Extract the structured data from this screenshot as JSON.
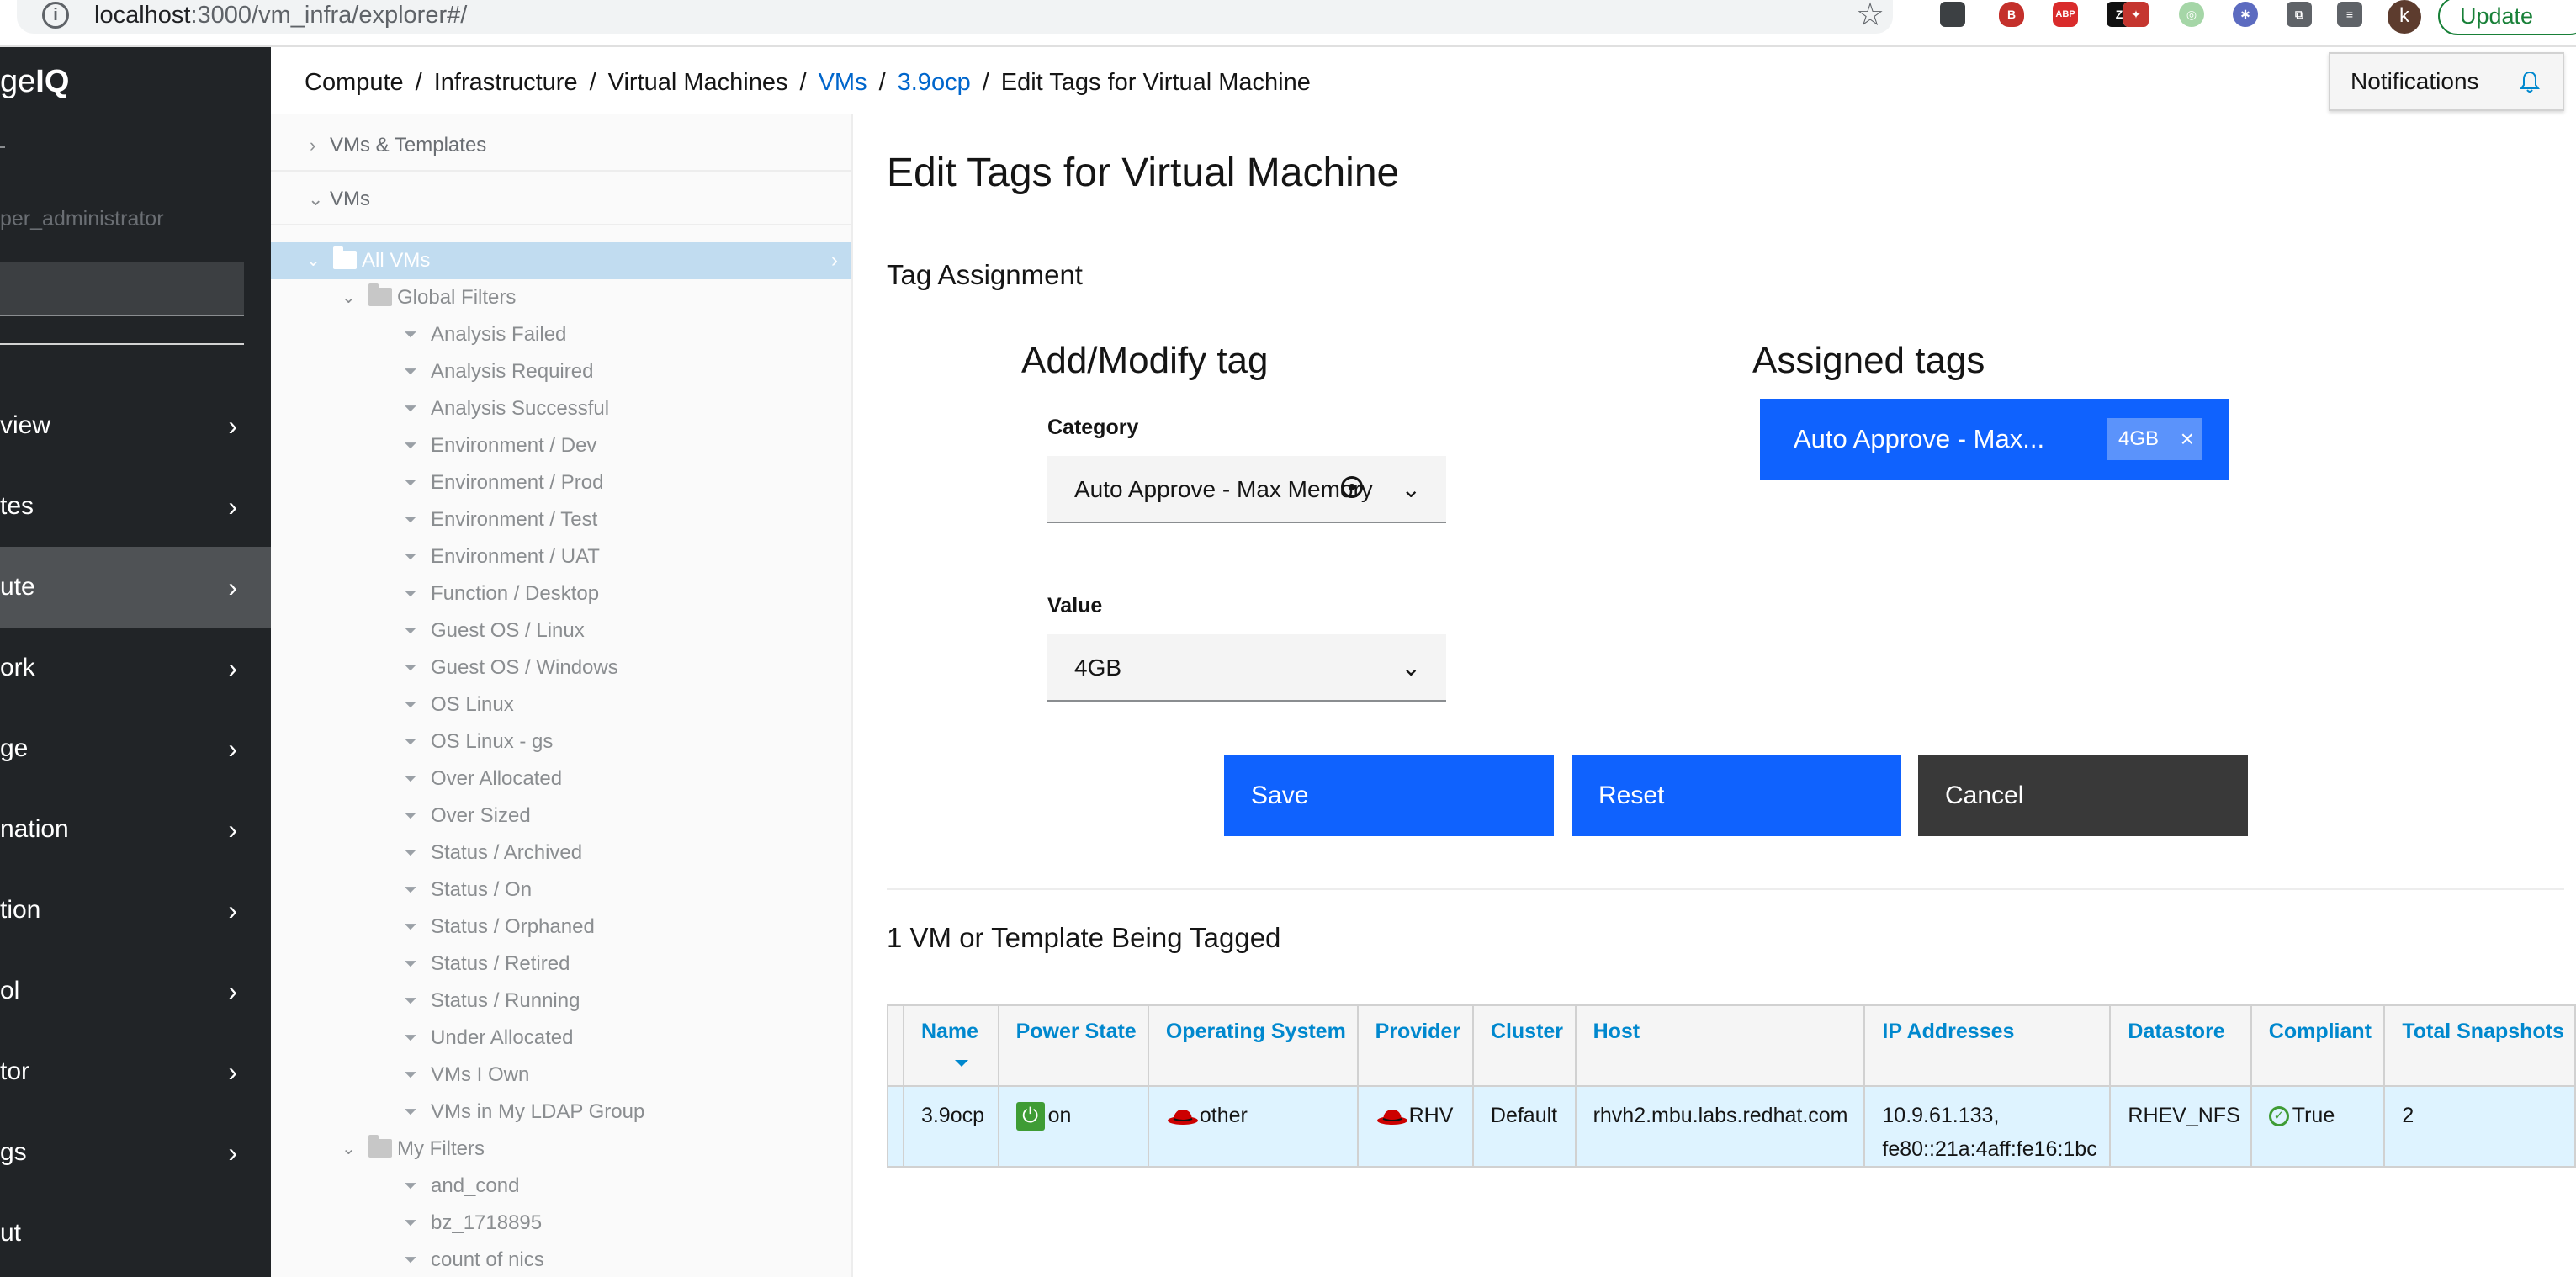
{
  "browser": {
    "url_host": "localhost",
    "url_path": ":3000/vm_infra/explorer#/",
    "avatar_letter": "k",
    "update_label": "Update"
  },
  "nav": {
    "brand_light": "ge",
    "brand_bold": "IQ",
    "role": "per_administrator",
    "items": [
      {
        "label": "view"
      },
      {
        "label": "tes"
      },
      {
        "label": "ute"
      },
      {
        "label": "ork"
      },
      {
        "label": "ge"
      },
      {
        "label": "nation"
      },
      {
        "label": "tion"
      },
      {
        "label": "ol"
      },
      {
        "label": "tor"
      },
      {
        "label": "gs"
      },
      {
        "label": "ut"
      }
    ]
  },
  "tree_panel": {
    "accordion_1": "VMs & Templates",
    "accordion_2": "VMs",
    "nodes": [
      {
        "label": "All VMs"
      },
      {
        "label": "Global Filters"
      },
      {
        "label": "Analysis Failed"
      },
      {
        "label": "Analysis Required"
      },
      {
        "label": "Analysis Successful"
      },
      {
        "label": "Environment / Dev"
      },
      {
        "label": "Environment / Prod"
      },
      {
        "label": "Environment / Test"
      },
      {
        "label": "Environment / UAT"
      },
      {
        "label": "Function / Desktop"
      },
      {
        "label": "Guest OS / Linux"
      },
      {
        "label": "Guest OS / Windows"
      },
      {
        "label": "OS Linux"
      },
      {
        "label": "OS Linux - gs"
      },
      {
        "label": "Over Allocated"
      },
      {
        "label": "Over Sized"
      },
      {
        "label": "Status / Archived"
      },
      {
        "label": "Status / On"
      },
      {
        "label": "Status / Orphaned"
      },
      {
        "label": "Status / Retired"
      },
      {
        "label": "Status / Running"
      },
      {
        "label": "Under Allocated"
      },
      {
        "label": "VMs I Own"
      },
      {
        "label": "VMs in My LDAP Group"
      },
      {
        "label": "My Filters"
      },
      {
        "label": "and_cond"
      },
      {
        "label": "bz_1718895"
      },
      {
        "label": "count of nics"
      }
    ]
  },
  "breadcrumb": {
    "items": [
      "Compute",
      "Infrastructure",
      "Virtual Machines",
      "VMs",
      "3.9ocp",
      "Edit Tags for Virtual Machine"
    ],
    "separator": "/"
  },
  "notifications_label": "Notifications",
  "page": {
    "title": "Edit Tags for Virtual Machine",
    "section": "Tag Assignment",
    "add_modify_title": "Add/Modify tag",
    "assigned_title": "Assigned tags",
    "category_label": "Category",
    "category_value": "Auto Approve - Max Memory",
    "value_label": "Value",
    "value_value": "4GB",
    "tag_name": "Auto Approve - Max...",
    "tag_value": "4GB",
    "tag_remove": "×",
    "save_label": "Save",
    "reset_label": "Reset",
    "cancel_label": "Cancel",
    "tagged_title": "1 VM or Template Being Tagged"
  },
  "table": {
    "headers": [
      "Name",
      "Power State",
      "Operating System",
      "Provider",
      "Cluster",
      "Host",
      "IP Addresses",
      "Datastore",
      "Compliant",
      "Total Snapshots"
    ],
    "row": {
      "name": "3.9ocp",
      "power": "on",
      "os": "other",
      "provider": "RHV",
      "cluster": "Default",
      "host": "rhvh2.mbu.labs.redhat.com",
      "ip_1": "10.9.61.133,",
      "ip_2": "fe80::21a:4aff:fe16:1bc",
      "datastore": "RHEV_NFS",
      "compliant": "True",
      "snapshots": "2"
    }
  },
  "colors": {
    "primary": "#0f62fe",
    "link": "#0066cc",
    "nav_bg": "#212427",
    "selected_row": "#def3ff",
    "power_on": "#3f9c35"
  }
}
